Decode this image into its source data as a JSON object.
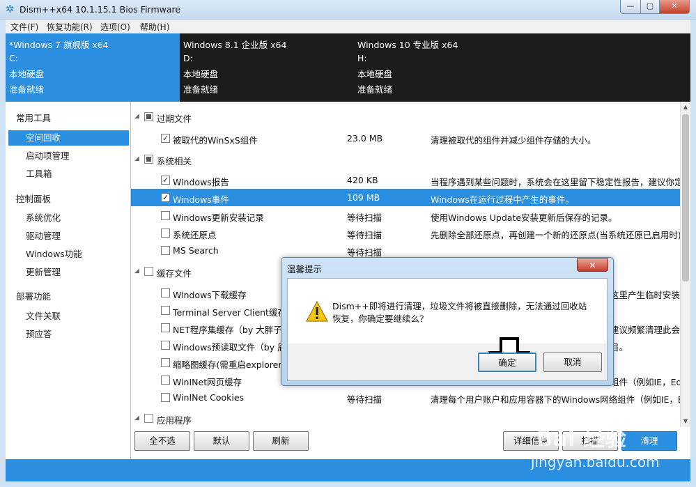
{
  "window": {
    "title": "Dism++x64 10.1.15.1 Bios Firmware",
    "min": "—",
    "max": "▢",
    "close": "✕"
  },
  "menu": [
    "文件(F)",
    "恢复功能(R)",
    "选项(O)",
    "帮助(H)"
  ],
  "images": [
    {
      "name": "*Windows 7 旗舰版 x64",
      "drive": "C:",
      "disk": "本地硬盘",
      "status": "准备就绪"
    },
    {
      "name": "Windows 8.1 企业版 x64",
      "drive": "D:",
      "disk": "本地硬盘",
      "status": "准备就绪"
    },
    {
      "name": "Windows 10 专业版 x64",
      "drive": "H:",
      "disk": "本地硬盘",
      "status": "准备就绪"
    }
  ],
  "sidebar": {
    "group1": "常用工具",
    "items1": [
      "空间回收",
      "启动项管理",
      "工具箱"
    ],
    "group2": "控制面板",
    "items2": [
      "系统优化",
      "驱动管理",
      "Windows功能",
      "更新管理"
    ],
    "group3": "部署功能",
    "items3": [
      "文件关联",
      "预应答"
    ]
  },
  "groups": [
    "过期文件",
    "系统相关",
    "缓存文件",
    "应用程序"
  ],
  "rows": [
    {
      "name": "被取代的WinSxS组件",
      "size": "23.0 MB",
      "desc": "清理被取代的组件并减少组件存储的大小。",
      "checked": "✓"
    },
    {
      "name": "Windows报告",
      "size": "420 KB",
      "desc": "当程序遇到某些问题时，系统会在这里留下稳定性报告，建议你定期",
      "checked": "✓"
    },
    {
      "name": "Windows事件",
      "size": "109 MB",
      "desc": "Windows在运行过程中产生的事件。",
      "checked": "✓"
    },
    {
      "name": "Windows更新安装记录",
      "size": "等待扫描",
      "desc": "使用Windows Update安装更新后保存的记录。",
      "checked": ""
    },
    {
      "name": "系统还原点",
      "size": "等待扫描",
      "desc": "先删除全部还原点，再创建一个新的还原点(当系统还原已启用时)",
      "checked": ""
    },
    {
      "name": "MS Search",
      "size": "等待扫描",
      "desc": "",
      "checked": ""
    },
    {
      "name": "Windows下载缓存",
      "size": "",
      "desc": "这里产生临时安装",
      "checked": ""
    },
    {
      "name": "Terminal Server Client缓存",
      "size": "",
      "desc": "。",
      "checked": ""
    },
    {
      "name": "NET程序集缓存（by 大胖子扫",
      "size": "",
      "desc": "建议频繁清理此会",
      "checked": ""
    },
    {
      "name": "Windows预读取文件（by 辰",
      "size": "",
      "desc": "目。",
      "checked": ""
    },
    {
      "name": "缩略图缓存(需重启explorer)",
      "size": "",
      "desc": "",
      "checked": ""
    },
    {
      "name": "WinINet网页缓存",
      "size": "",
      "desc": "组件（例如IE，Ed",
      "checked": ""
    },
    {
      "name": "WinINet Cookies",
      "size": "等待扫描",
      "desc": "清理每个用户账户和应用容器下的Windows网络组件（例如IE，Ed",
      "checked": ""
    }
  ],
  "buttons": {
    "select_none": "全不选",
    "default": "默认",
    "refresh": "刷新",
    "details": "详细信息",
    "scan": "扫描",
    "clean": "清理"
  },
  "dialog": {
    "title": "温馨提示",
    "close": "✕",
    "message": "Dism++即将进行清理，垃圾文件将被直接删除，无法通过回收站恢复，你确定要继续么？",
    "ok": "确定",
    "cancel": "取消"
  },
  "scroll": {
    "up": "▲",
    "down": "▼"
  },
  "tree_arrow": "◢",
  "app_icon": "✲",
  "watermark": {
    "logo": "Bai 经验",
    "url": "jingyan.baidu.com"
  },
  "colors": {
    "accent": "#2a8fe0",
    "header_bg": "#1c1c1c"
  }
}
